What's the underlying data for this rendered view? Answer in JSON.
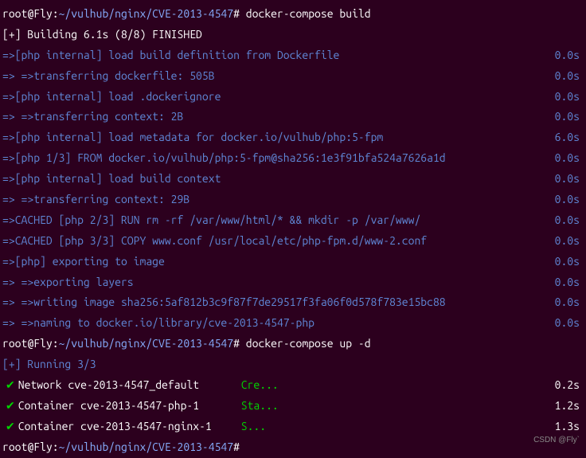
{
  "prompt1": {
    "userhost": "root@Fly",
    "separator": ":",
    "tilde": "~",
    "path": "/vulhub/nginx/CVE-2013-4547",
    "hash": "#",
    "command": "docker-compose build"
  },
  "building_line": "[+] Building 6.1s (8/8) FINISHED",
  "build_steps": [
    {
      "prefix": " => ",
      "text": "[php internal] load build definition from Dockerfile",
      "time": "0.0s"
    },
    {
      "prefix": " => => ",
      "text": "transferring dockerfile: 505B",
      "time": "0.0s"
    },
    {
      "prefix": " => ",
      "text": "[php internal] load .dockerignore",
      "time": "0.0s"
    },
    {
      "prefix": " => => ",
      "text": "transferring context: 2B",
      "time": "0.0s"
    },
    {
      "prefix": " => ",
      "text": "[php internal] load metadata for docker.io/vulhub/php:5-fpm",
      "time": "6.0s"
    },
    {
      "prefix": " => ",
      "text": "[php 1/3] FROM docker.io/vulhub/php:5-fpm@sha256:1e3f91bfa524a7626a1d",
      "time": "0.0s"
    },
    {
      "prefix": " => ",
      "text": "[php internal] load build context",
      "time": "0.0s"
    },
    {
      "prefix": " => => ",
      "text": "transferring context: 29B",
      "time": "0.0s"
    },
    {
      "prefix": " => ",
      "text": "CACHED [php 2/3] RUN rm -rf /var/www/html/*     && mkdir -p /var/www/",
      "time": "0.0s"
    },
    {
      "prefix": " => ",
      "text": "CACHED [php 3/3] COPY www.conf /usr/local/etc/php-fpm.d/www-2.conf",
      "time": "0.0s"
    },
    {
      "prefix": " => ",
      "text": "[php] exporting to image",
      "time": "0.0s"
    },
    {
      "prefix": " => => ",
      "text": "exporting layers",
      "time": "0.0s"
    },
    {
      "prefix": " => => ",
      "text": "writing image sha256:5af812b3c9f87f7de29517f3fa06f0d578f783e15bc88",
      "time": "0.0s"
    },
    {
      "prefix": " => => ",
      "text": "naming to docker.io/library/cve-2013-4547-php",
      "time": "0.0s"
    }
  ],
  "prompt2": {
    "userhost": "root@Fly",
    "separator": ":",
    "tilde": "~",
    "path": "/vulhub/nginx/CVE-2013-4547",
    "hash": "#",
    "command": "docker-compose up -d"
  },
  "running_line": "[+] Running 3/3",
  "run_steps": [
    {
      "name": "Network cve-2013-4547_default",
      "status": "Cre...",
      "time": "0.2s"
    },
    {
      "name": "Container cve-2013-4547-php-1",
      "status": "Sta...",
      "time": "1.2s"
    },
    {
      "name": "Container cve-2013-4547-nginx-1",
      "status": "S...",
      "time": "1.3s"
    }
  ],
  "prompt3": {
    "userhost": "root@Fly",
    "separator": ":",
    "tilde": "~",
    "path": "/vulhub/nginx/CVE-2013-4547",
    "hash": "#",
    "command": ""
  },
  "watermark": "CSDN @Fly`",
  "checkmark_char": "✔"
}
